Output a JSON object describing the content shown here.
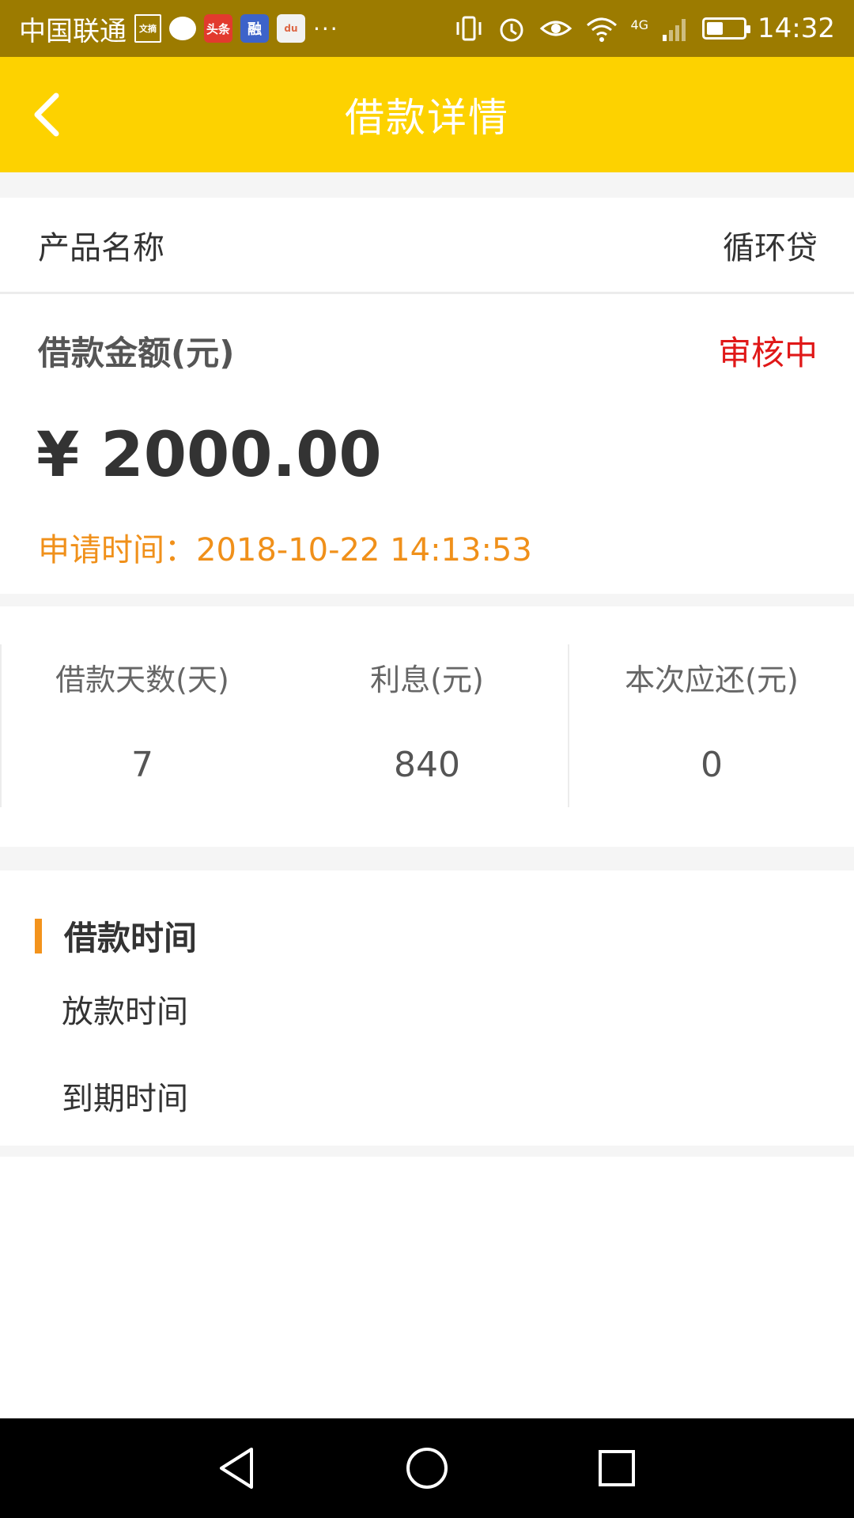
{
  "status_bar": {
    "carrier": "中国联通",
    "wenzhai_label": "文摘",
    "toutiao_label": "头条",
    "rong_label": "融",
    "du_label": "du",
    "more": "···",
    "network": "4G",
    "time": "14:32",
    "battery_fill_percent": 45
  },
  "header": {
    "title": "借款详情"
  },
  "product": {
    "label": "产品名称",
    "value": "循环贷"
  },
  "amount": {
    "label": "借款金额(元)",
    "status": "审核中",
    "value": "¥ 2000.00",
    "apply_time": "申请时间：2018-10-22 14:13:53"
  },
  "stats": [
    {
      "label": "借款天数(天)",
      "value": "7"
    },
    {
      "label": "利息(元)",
      "value": "840"
    },
    {
      "label": "本次应还(元)",
      "value": "0"
    }
  ],
  "loan_time": {
    "title": "借款时间",
    "items": [
      "放款时间",
      "到期时间"
    ]
  },
  "colors": {
    "header_yellow": "#fdd200",
    "status_bar": "#9c7b00",
    "status_red": "#e01818",
    "accent_orange": "#f0901a"
  },
  "icons": {
    "back": "chevron-left-icon",
    "nav_back": "triangle-back-icon",
    "nav_home": "circle-home-icon",
    "nav_recent": "square-recent-icon"
  }
}
